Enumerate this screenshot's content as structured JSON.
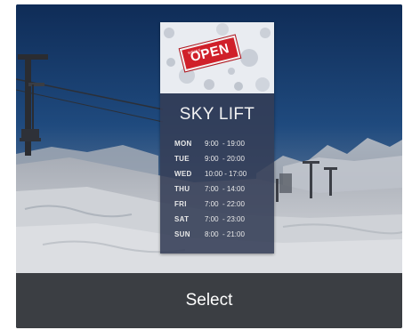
{
  "card": {
    "title": "SKY LIFT",
    "sign_text": "OPEN",
    "sign_small_text": "WE'RE",
    "schedule": [
      {
        "day": "MON",
        "time": "9:00  - 19:00"
      },
      {
        "day": "TUE",
        "time": "9:00  - 20:00"
      },
      {
        "day": "WED",
        "time": "10:00 - 17:00"
      },
      {
        "day": "THU",
        "time": "7:00  - 14:00"
      },
      {
        "day": "FRI",
        "time": "7:00  - 22:00"
      },
      {
        "day": "SAT",
        "time": "7:00  - 23:00"
      },
      {
        "day": "SUN",
        "time": "8:00  - 21:00"
      }
    ],
    "select_label": "Select"
  },
  "colors": {
    "sign_red": "#d0202a",
    "poster_bg": "#343e56",
    "select_bar_bg": "#3b3e43",
    "sky_top": "#1a3a66",
    "snow": "#c9ccd2"
  }
}
